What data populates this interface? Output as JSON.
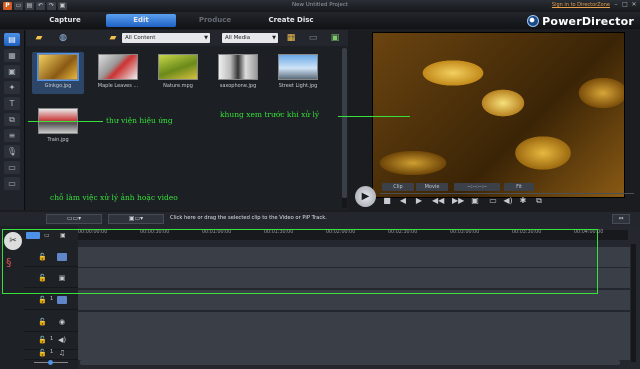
{
  "window": {
    "title": "New Untitled Project",
    "signin_link": "Sign in to DirectorZone",
    "minimize": "–",
    "maximize": "□",
    "close": "✕"
  },
  "modes": {
    "capture": "Capture",
    "edit": "Edit",
    "produce": "Produce",
    "create_disc": "Create Disc"
  },
  "brand": {
    "name": "PowerDirector"
  },
  "library": {
    "content_filter": "All Content",
    "media_filter": "All Media",
    "items": [
      {
        "label": "Ginkgo.jpg"
      },
      {
        "label": "Maple Leaves ..."
      },
      {
        "label": "Nature.mpg"
      },
      {
        "label": "saxophone.jpg"
      },
      {
        "label": "Street Light.jpg"
      },
      {
        "label": "Train.jpg"
      }
    ]
  },
  "preview": {
    "clip_label": "Clip",
    "movie_label": "Movie",
    "timecode": "--:--:--:--",
    "fit_label": "Fit"
  },
  "timeline": {
    "hint": "Click here or drag the selected clip to the Video or PiP Track.",
    "ticks": [
      "00:00:00:00",
      "00:00:30:00",
      "00:01:00:00",
      "00:01:30:00",
      "00:02:00:00",
      "00:02:30:00",
      "00:03:00:00",
      "00:03:30:00",
      "00:04:00:00"
    ],
    "track_numbers": [
      "1",
      "1",
      "1"
    ]
  },
  "annotations": {
    "library_note": "thư viện hiệu ứng",
    "preview_note": "khung xem trước khi xử lý",
    "workarea_note": "chỗ làm việc xử lý ảnh hoặc video"
  },
  "colors": {
    "accent": "#1f62c4",
    "annotation": "#37e03a"
  }
}
